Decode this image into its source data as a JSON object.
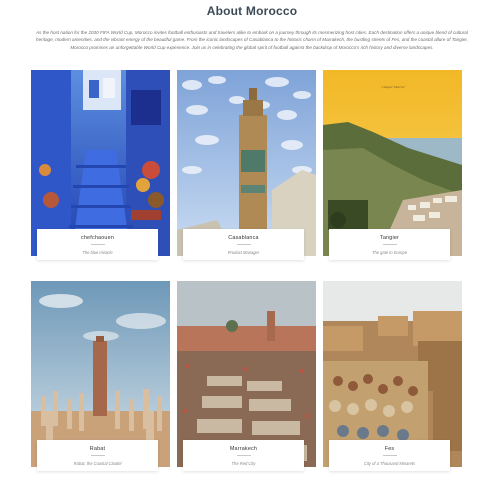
{
  "page": {
    "title": "About Morocco",
    "intro": "As the host nation for the 2030 FIFA World Cup, Morocco invites football enthusiasts and travelers alike to embark on a journey through its mesmerizing host cities. Each destination offers a unique blend of cultural heritage, modern amenities, and the vibrant energy of the beautiful game. From the iconic landscapes of Casablanca to the historic charm of Marrakech, the bustling streets of Fes, and the coastal allure of Tangier, Morocco promises an unforgettable World Cup experience. Join us in celebrating the global spirit of football against the backdrop of Morocco's rich history and diverse landscapes."
  },
  "cities": [
    {
      "name": "chefchaouen",
      "tagline": "The blue miracle",
      "photo": "blue-alley-stairs"
    },
    {
      "name": "Casablanca",
      "tagline": "Product Manager",
      "photo": "hassan-ii-minaret"
    },
    {
      "name": "Tangier",
      "tagline": "The gate to Europe",
      "photo": "coastal-sunset"
    },
    {
      "name": "Rabat",
      "tagline": "Rabat, the Coastal Citadel",
      "photo": "hassan-tower-columns"
    },
    {
      "name": "Marrakech",
      "tagline": "The Red City",
      "photo": "jemaa-el-fnaa-square"
    },
    {
      "name": "Fes",
      "tagline": "City of a Thousand Minarets",
      "photo": "tanneries-rooftops"
    }
  ],
  "sun_caption": "Chapter Marché"
}
